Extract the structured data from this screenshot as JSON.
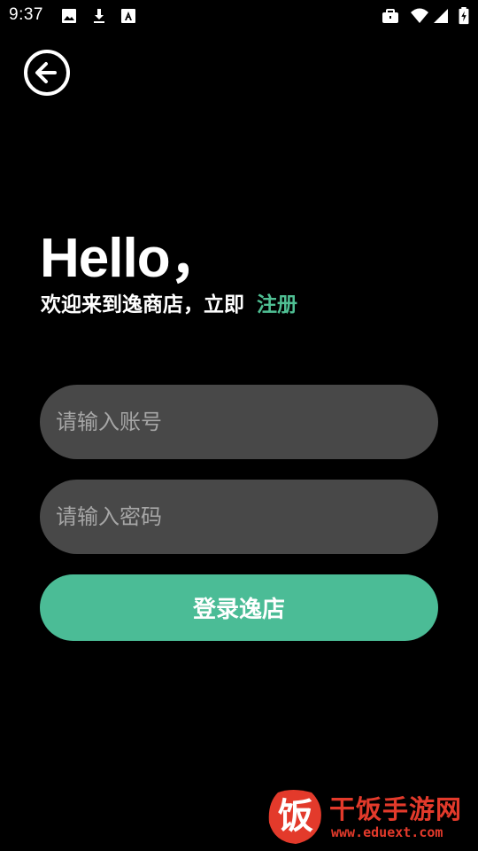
{
  "status_bar": {
    "time": "9:37",
    "icons": [
      "image-icon",
      "download-icon",
      "font-icon",
      "briefcase-icon",
      "wifi-icon",
      "signal-icon",
      "battery-icon"
    ]
  },
  "header": {
    "back_icon": "arrow-left-circle-icon"
  },
  "greeting": {
    "title": "Hello，",
    "subtitle": "欢迎来到逸商店，立即",
    "register_link": "注册"
  },
  "form": {
    "account_placeholder": "请输入账号",
    "account_value": "",
    "password_placeholder": "请输入密码",
    "password_value": "",
    "login_label": "登录逸店"
  },
  "watermark": {
    "logo_char": "饭",
    "title": "干饭手游网",
    "url": "www.eduext.com"
  },
  "colors": {
    "background": "#000000",
    "accent": "#4bbc96",
    "field_bg": "#484848",
    "placeholder": "#a6a6a6",
    "watermark": "#e33a2b"
  }
}
